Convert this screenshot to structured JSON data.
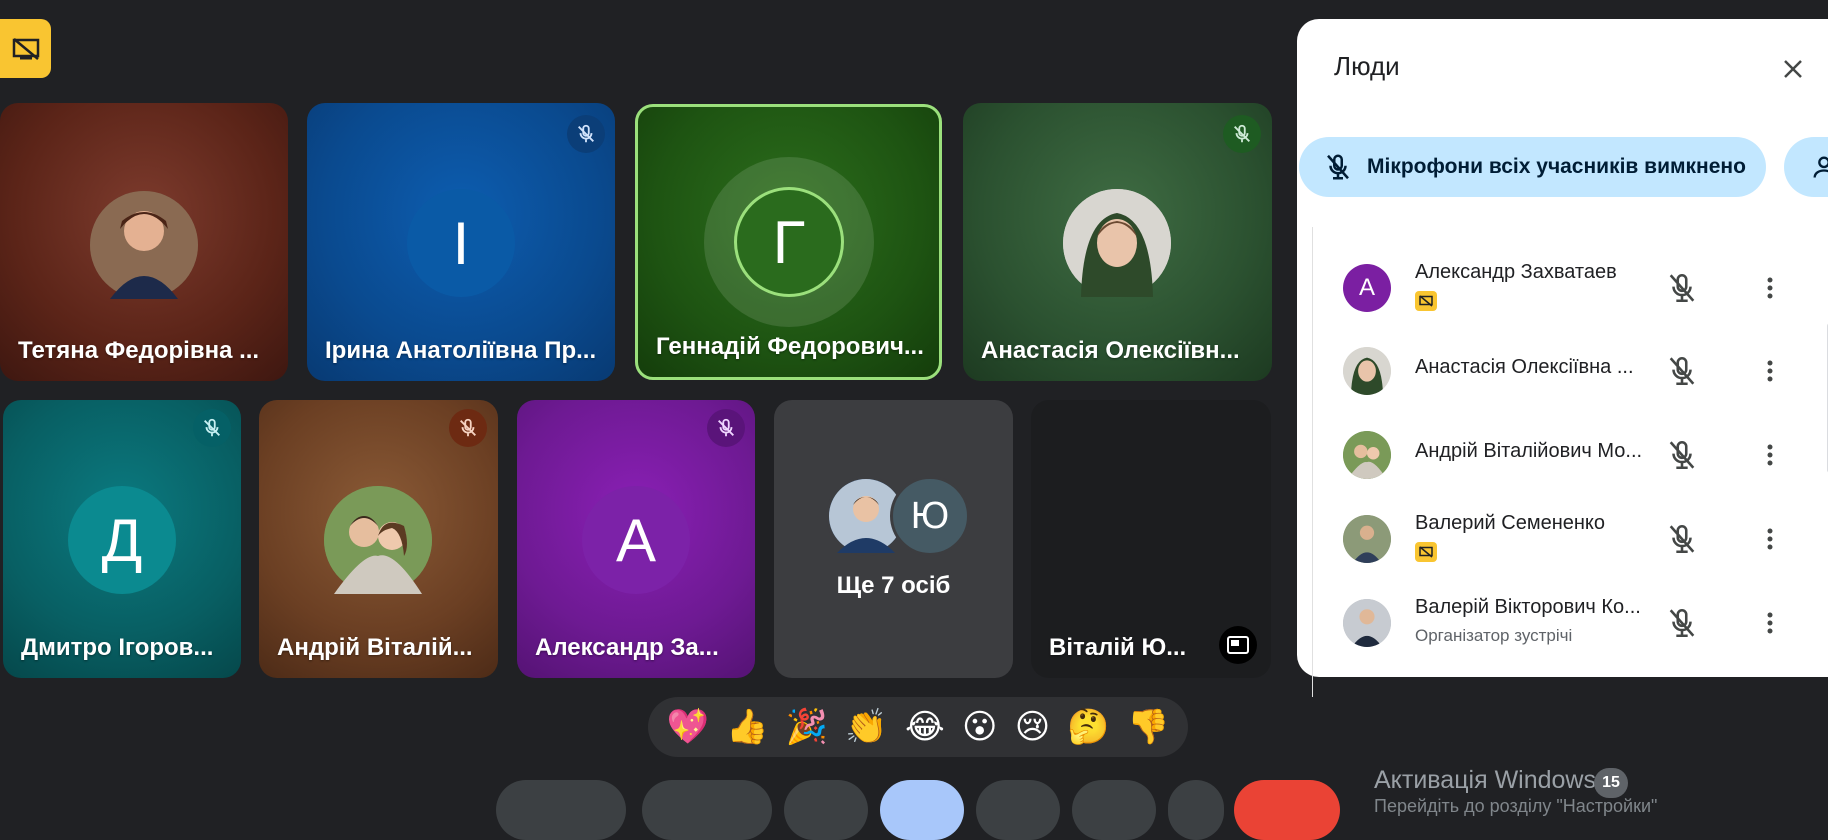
{
  "tiles": [
    {
      "name": "Тетяна Федорівна ..."
    },
    {
      "name": "Ірина Анатоліївна Пр...",
      "initial": "І"
    },
    {
      "name": "Геннадій Федорович...",
      "initial": "Г"
    },
    {
      "name": "Анастасія Олексіївн..."
    },
    {
      "name": "Дмитро Ігоров...",
      "initial": "Д"
    },
    {
      "name": "Андрій Віталій..."
    },
    {
      "name": "Александр За...",
      "initial": "А"
    },
    {
      "label": "Ще 7 осіб",
      "initial": "Ю"
    },
    {
      "name": "Віталій Ю..."
    }
  ],
  "emojis": [
    "💖",
    "👍",
    "🎉",
    "👏",
    "😂",
    "😮",
    "😢",
    "🤔",
    "👎"
  ],
  "panel": {
    "title": "Люди",
    "mute_chip": "Мікрофони всіх учасників вимкнено",
    "people": [
      {
        "name": "Александр Захватаев",
        "initial": "А",
        "color": "#7b1fa2"
      },
      {
        "name": "Анастасія Олексіївна ..."
      },
      {
        "name": "Андрій Віталійович Мо..."
      },
      {
        "name": "Валерий Семененко"
      },
      {
        "name": "Валерій Вікторович Ко...",
        "sub": "Організатор зустрічі"
      }
    ]
  },
  "watermark": {
    "title": "Активація Windows",
    "count": "15",
    "sub": "Перейдіть до розділу \"Настройки\""
  },
  "colors": {
    "accent_yellow": "#f9c531",
    "chip_blue": "#c2e7ff",
    "speaking_border": "#9be07c"
  }
}
